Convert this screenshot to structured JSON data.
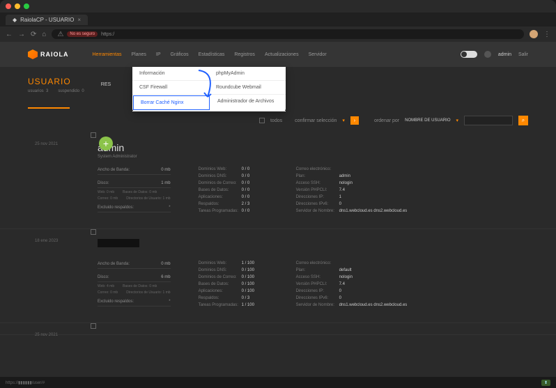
{
  "browser": {
    "tab_title": "RaiolaCP - USUARIO",
    "insecure_label": "No es seguro",
    "url_prefix": "https:/"
  },
  "brand": "RAIOLA",
  "nav": {
    "items": [
      "Herramientas",
      "Planes",
      "IP",
      "Gráficos",
      "Estadísticas",
      "Registros",
      "Actualizaciones",
      "Servidor"
    ],
    "user": "admin",
    "logout": "Salir"
  },
  "dropdown": {
    "rows": [
      [
        "Información",
        "phpMyAdmin"
      ],
      [
        "CSF Firewall",
        "Roundcube Webmail"
      ],
      [
        "Borrar Caché Nginx",
        "Administrador de Archivos"
      ]
    ]
  },
  "page": {
    "title": "USUARIO",
    "tab_res": "RES",
    "stats": {
      "usuarios": "usuarios",
      "usuarios_n": "3",
      "susp": "suspendido",
      "susp_n": "0"
    }
  },
  "toolbar": {
    "todos": "todos",
    "confirm": "confirmar selección",
    "ordenar": "ordenar por",
    "sort": "NOMBRE DE USUARIO"
  },
  "labels": {
    "ancho": "Ancho de Banda:",
    "disco": "Disco:",
    "web": "Web:",
    "bd": "Bases de Datos:",
    "correo": "Correo:",
    "dir": "Directorios de Usuario:",
    "excl": "Excluido respaldos:",
    "domweb": "Dominios Web:",
    "domdns": "Dominios DNS:",
    "domcorreo": "Dominios de Correo:",
    "bdatos": "Bases de Datos:",
    "apl": "Aplicaciones:",
    "resp": "Respaldos:",
    "tareas": "Tareas Programadas:",
    "correo_e": "Correo electrónico:",
    "plan": "Plan:",
    "ssh": "Acceso SSH:",
    "phpcli": "Versión PHPCLI:",
    "ip": "Direcciones IP:",
    "ipv6": "Direcciones IPv6:",
    "ns": "Servidor de Nombre:"
  },
  "users": [
    {
      "date": "25 nov 2021",
      "name": "admin",
      "role": "System Administrator",
      "ancho": "0 mb",
      "disco": "1 mb",
      "web": "0 mb",
      "bd": "0 mb",
      "correo": "0 mb",
      "dir": "1 mb",
      "excl": "*",
      "domweb": "0 / 0",
      "domdns": "0 / 0",
      "domcorreo": "0 / 0",
      "bdatos": "0 / 0",
      "apl": "0 / 0",
      "resp": "2 / 3",
      "tareas": "0 / 0",
      "plan": "admin",
      "ssh": "nologin",
      "phpcli": "7.4",
      "ip": "1",
      "ipv6": "0",
      "ns": "dns1.webcloud.es dns2.webcloud.es"
    },
    {
      "date": "18 ene 2023",
      "name": "",
      "role": "",
      "ancho": "0 mb",
      "disco": "6 mb",
      "web": "4 mb",
      "bd": "0 mb",
      "correo": "0 mb",
      "dir": "1 mb",
      "excl": "*",
      "domweb": "1 / 100",
      "domdns": "0 / 100",
      "domcorreo": "0 / 100",
      "bdatos": "0 / 100",
      "apl": "0 / 100",
      "resp": "0 / 3",
      "tareas": "1 / 100",
      "plan": "default",
      "ssh": "nologin",
      "phpcli": "7.4",
      "ip": "0",
      "ipv6": "0",
      "ns": "dns1.webcloud.es dns2.webcloud.es"
    }
  ],
  "footer_date": "25 nov 2021"
}
